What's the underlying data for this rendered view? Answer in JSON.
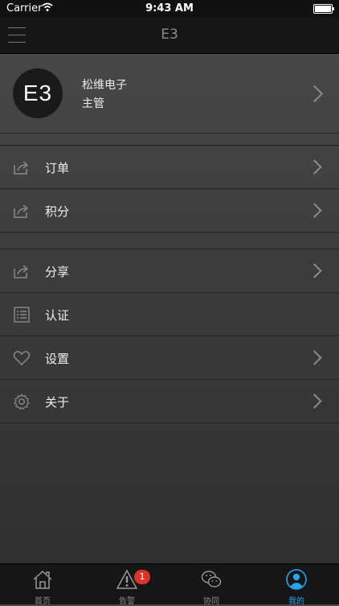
{
  "status_bar": {
    "carrier": "Carrier",
    "time": "9:43 AM"
  },
  "nav": {
    "title": "E3"
  },
  "profile": {
    "avatar_text": "E3",
    "company": "松维电子",
    "role": "主管"
  },
  "menu_group1": [
    {
      "label": "订单",
      "icon": "share-icon",
      "has_chevron": true
    },
    {
      "label": "积分",
      "icon": "share-icon",
      "has_chevron": true
    }
  ],
  "menu_group2": [
    {
      "label": "分享",
      "icon": "share-icon",
      "has_chevron": true
    },
    {
      "label": "认证",
      "icon": "list-icon",
      "has_chevron": false
    },
    {
      "label": "设置",
      "icon": "heart-icon",
      "has_chevron": true
    },
    {
      "label": "关于",
      "icon": "gear-icon",
      "has_chevron": true
    }
  ],
  "tabs": [
    {
      "label": "首页",
      "icon": "home-icon"
    },
    {
      "label": "告警",
      "icon": "warning-icon",
      "badge": "1"
    },
    {
      "label": "协同",
      "icon": "wechat-icon"
    },
    {
      "label": "我的",
      "icon": "user-icon",
      "active": true
    }
  ],
  "colors": {
    "accent": "#29a3ef",
    "badge": "#d9342b",
    "nav_bg": "#161616"
  }
}
